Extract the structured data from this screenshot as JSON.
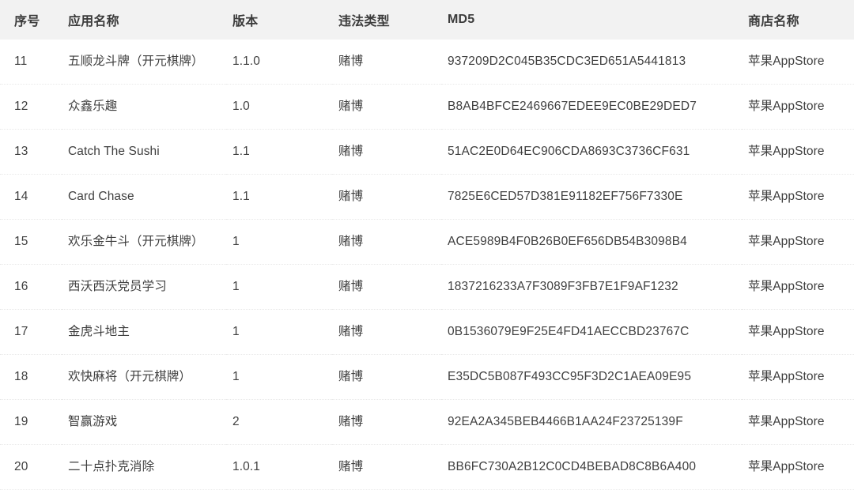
{
  "table": {
    "headers": {
      "index": "序号",
      "app_name": "应用名称",
      "version": "版本",
      "violation_type": "违法类型",
      "md5": "MD5",
      "store_name": "商店名称"
    },
    "rows": [
      {
        "index": "11",
        "app_name": "五顺龙斗牌（开元棋牌）",
        "version": "1.1.0",
        "violation_type": "赌博",
        "md5": "937209D2C045B35CDC3ED651A5441813",
        "store_name": "苹果AppStore"
      },
      {
        "index": "12",
        "app_name": "众鑫乐趣",
        "version": "1.0",
        "violation_type": "赌博",
        "md5": "B8AB4BFCE2469667EDEE9EC0BE29DED7",
        "store_name": "苹果AppStore"
      },
      {
        "index": "13",
        "app_name": "Catch The Sushi",
        "version": "1.1",
        "violation_type": "赌博",
        "md5": "51AC2E0D64EC906CDA8693C3736CF631",
        "store_name": "苹果AppStore"
      },
      {
        "index": "14",
        "app_name": "Card Chase",
        "version": "1.1",
        "violation_type": "赌博",
        "md5": "7825E6CED57D381E91182EF756F7330E",
        "store_name": "苹果AppStore"
      },
      {
        "index": "15",
        "app_name": "欢乐金牛斗（开元棋牌）",
        "version": "1",
        "violation_type": "赌博",
        "md5": "ACE5989B4F0B26B0EF656DB54B3098B4",
        "store_name": "苹果AppStore"
      },
      {
        "index": "16",
        "app_name": "西沃西沃党员学习",
        "version": "1",
        "violation_type": "赌博",
        "md5": "1837216233A7F3089F3FB7E1F9AF1232",
        "store_name": "苹果AppStore"
      },
      {
        "index": "17",
        "app_name": "金虎斗地主",
        "version": "1",
        "violation_type": "赌博",
        "md5": "0B1536079E9F25E4FD41AECCBD23767C",
        "store_name": "苹果AppStore"
      },
      {
        "index": "18",
        "app_name": "欢快麻将（开元棋牌）",
        "version": "1",
        "violation_type": "赌博",
        "md5": "E35DC5B087F493CC95F3D2C1AEA09E95",
        "store_name": "苹果AppStore"
      },
      {
        "index": "19",
        "app_name": "智赢游戏",
        "version": "2",
        "violation_type": "赌博",
        "md5": "92EA2A345BEB4466B1AA24F23725139F",
        "store_name": "苹果AppStore"
      },
      {
        "index": "20",
        "app_name": "二十点扑克消除",
        "version": "1.0.1",
        "violation_type": "赌博",
        "md5": "BB6FC730A2B12C0CD4BEBAD8C8B6A400",
        "store_name": "苹果AppStore"
      }
    ]
  },
  "colors": {
    "header_background": "#f2f2f2",
    "header_text": "#3b3b3b",
    "body_text": "#3f3f3f",
    "divider": "#e9e9e9",
    "page_background": "#ffffff"
  }
}
